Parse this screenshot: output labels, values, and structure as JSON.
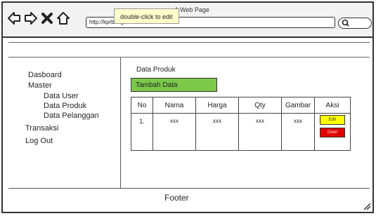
{
  "browser": {
    "window_title": "A Web Page",
    "tooltip": "double-click to edit",
    "url": "http://kprbtn.gold",
    "icons": [
      "back-arrow-icon",
      "forward-arrow-icon",
      "close-x-icon",
      "home-icon",
      "search-icon"
    ]
  },
  "sidebar": {
    "items": [
      {
        "label": "Dasboard"
      },
      {
        "label": "Master"
      },
      {
        "label": "Data User"
      },
      {
        "label": "Data Produk"
      },
      {
        "label": "Data Pelanggan"
      },
      {
        "label": "Transaksi"
      },
      {
        "label": "Log Out"
      }
    ]
  },
  "main": {
    "heading": "Data Produk",
    "add_button": "Tambah Data",
    "table": {
      "headers": [
        "No",
        "Nama",
        "Harga",
        "Qty",
        "Gambar",
        "Aksi"
      ],
      "rows": [
        {
          "no": "1.",
          "nama": "xxx",
          "harga": "xxx",
          "qty": "xxx",
          "gambar": "xxx"
        }
      ],
      "actions": {
        "edit": "Edit",
        "delete": "Delet"
      }
    }
  },
  "footer": {
    "text": "Footer"
  },
  "colors": {
    "add_button": "#7cc84a",
    "edit_button": "#ffff00",
    "delete_button": "#e00000",
    "tooltip_bg": "#ffffcc"
  }
}
